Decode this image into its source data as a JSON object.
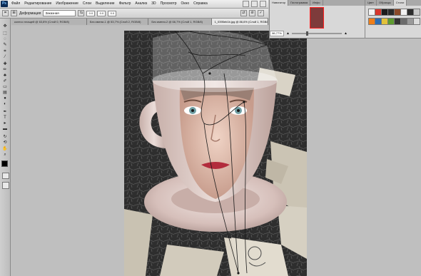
{
  "app": {
    "logo": "Ps",
    "menu": [
      "Файл",
      "Редактирование",
      "Изображение",
      "Слои",
      "Выделение",
      "Фильтр",
      "Анализ",
      "3D",
      "Просмотр",
      "Окно",
      "Справка"
    ]
  },
  "options": {
    "warp_label": "Деформация",
    "warp_style": "Заказная",
    "field_values": [
      "0.0",
      "0.0",
      "0.0"
    ]
  },
  "tabs": [
    {
      "label": "колесо плащей @ 63,8% (Слой 0, RGB/8)"
    },
    {
      "label": "Без имени-1 @ 53,7% (Слой 2, RGB/8)"
    },
    {
      "label": "Без имени-2 @ 66,7% (Слой 1, RGB/8)"
    },
    {
      "label": "1_0395eb1b.jpg @ 86,6% (Слой 1, RGB/8)",
      "active": true
    }
  ],
  "navigator": {
    "tabs": [
      "Навигатор",
      "Гистограмма",
      "Инфо"
    ],
    "zoom": "86,77%"
  },
  "styles_panel": {
    "tabs": [
      "Цвет",
      "Образцы",
      "Стили"
    ],
    "swatch_colors": [
      "#f4f4f4",
      "#d7362c",
      "#1c1c1c",
      "#2a2a2a",
      "#8b4a2a",
      "#f2f2f2",
      "#2d2d2d",
      "#c9c9c9",
      "#ef7f1a",
      "#2b6db5",
      "#e2c23a",
      "#5d9b2f",
      "#333333",
      "#6b6b6b",
      "#9a9a9a",
      "#dcdcdc"
    ]
  },
  "tools": [
    "move-icon",
    "marquee-icon",
    "lasso-icon",
    "quick-select-icon",
    "crop-icon",
    "eyedropper-icon",
    "healing-icon",
    "brush-icon",
    "stamp-icon",
    "history-brush-icon",
    "eraser-icon",
    "gradient-icon",
    "blur-icon",
    "dodge-icon",
    "pen-icon",
    "type-icon",
    "path-select-icon",
    "shape-icon",
    "3d-rotate-icon",
    "3d-camera-icon",
    "hand-icon",
    "zoom-icon"
  ],
  "colors": {
    "foreground": "#000000",
    "background": "#ffffff"
  }
}
